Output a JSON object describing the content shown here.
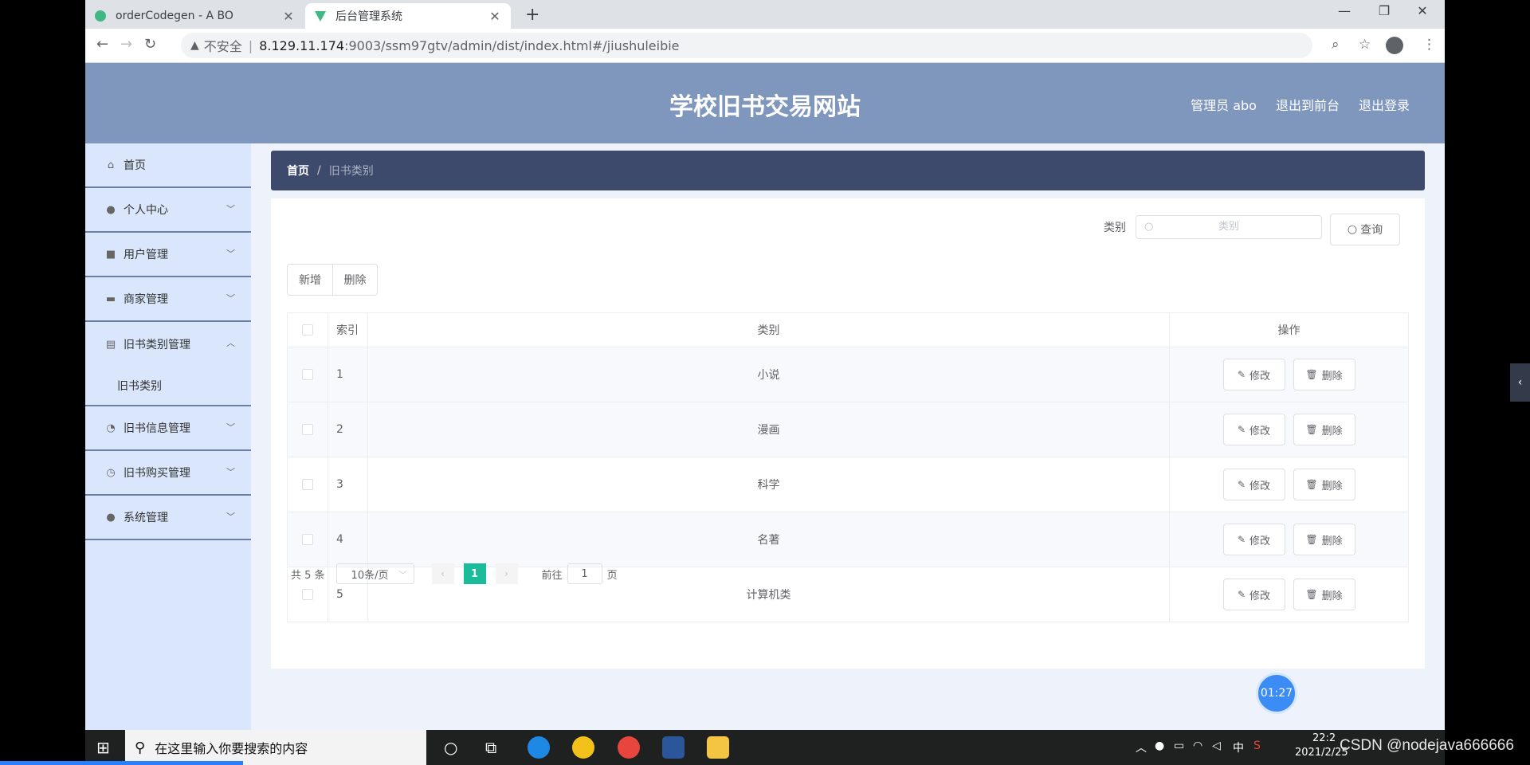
{
  "browser": {
    "tabs": [
      {
        "title": "orderCodegen - A BO",
        "active": false
      },
      {
        "title": "后台管理系统",
        "active": true
      }
    ],
    "address": {
      "insecure_label": "不安全",
      "host": "8.129.11.174",
      "path": ":9003/ssm97gtv/admin/dist/index.html#/jiushuleibie"
    }
  },
  "header": {
    "title": "学校旧书交易网站",
    "links": [
      "管理员 abo",
      "退出到前台",
      "退出登录"
    ]
  },
  "sidebar": {
    "items": [
      {
        "label": "首页",
        "icon": "home-icon"
      },
      {
        "label": "个人中心",
        "icon": "user-icon"
      },
      {
        "label": "用户管理",
        "icon": "briefcase-icon"
      },
      {
        "label": "商家管理",
        "icon": "truck-icon"
      },
      {
        "label": "旧书类别管理",
        "icon": "clipboard-icon",
        "expanded": true
      },
      {
        "label": "旧书信息管理",
        "icon": "gauge-icon"
      },
      {
        "label": "旧书购买管理",
        "icon": "clock-icon"
      },
      {
        "label": "系统管理",
        "icon": "user-icon"
      }
    ],
    "submenu": "旧书类别"
  },
  "breadcrumb": {
    "home": "首页",
    "sep": "/",
    "current": "旧书类别"
  },
  "search": {
    "label": "类别",
    "placeholder": "类别",
    "button": "查询"
  },
  "toolbar": {
    "add": "新增",
    "delete": "删除"
  },
  "table": {
    "headers": [
      "索引",
      "类别",
      "操作"
    ],
    "rows": [
      {
        "index": "1",
        "category": "小说"
      },
      {
        "index": "2",
        "category": "漫画"
      },
      {
        "index": "3",
        "category": "科学"
      },
      {
        "index": "4",
        "category": "名著"
      },
      {
        "index": "5",
        "category": "计算机类"
      }
    ],
    "edit_label": "修改",
    "delete_label": "删除"
  },
  "pagination": {
    "total": "共 5 条",
    "page_size": "10条/页",
    "current": "1",
    "goto_prefix": "前往",
    "goto_value": "1",
    "goto_suffix": "页"
  },
  "timer": "01:27",
  "taskbar": {
    "search_placeholder": "在这里输入你要搜索的内容",
    "ime": "中",
    "time": "22:2",
    "date": "2021/2/25"
  },
  "watermark": "CSDN @nodejava666666",
  "colors": {
    "header": "#7f97bd",
    "sidebar": "#d9e6fb",
    "breadcrumb": "#3e4a6b",
    "accent": "#1abc9c"
  }
}
